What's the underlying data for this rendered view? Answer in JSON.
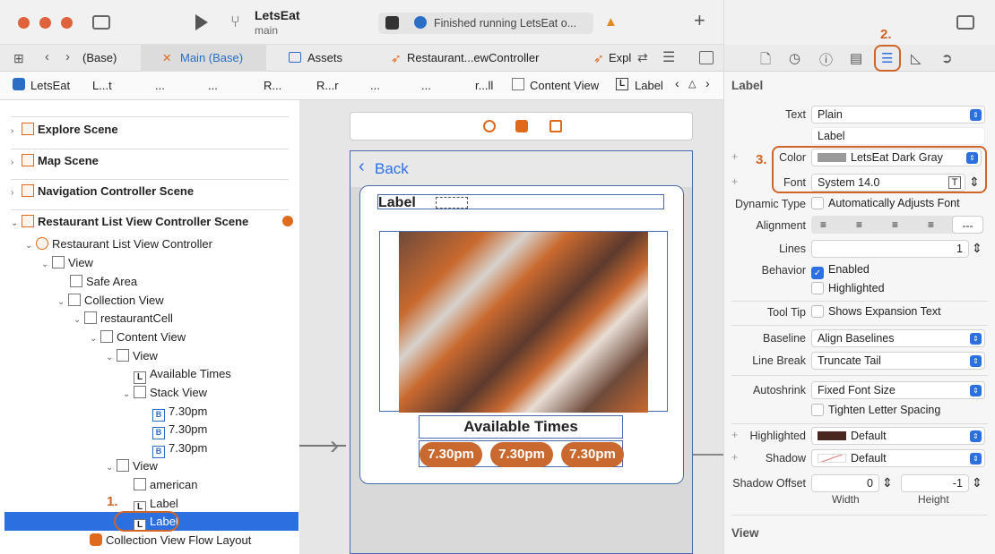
{
  "toolbar": {
    "project": "LetsEat",
    "branch": "main",
    "status": "Finished running LetsEat o...",
    "add": "+"
  },
  "tabs": [
    {
      "label": "(Base)"
    },
    {
      "label": "Main (Base)"
    },
    {
      "label": "Assets"
    },
    {
      "label": "Restaurant...ewController"
    },
    {
      "label": "Expl"
    }
  ],
  "breadcrumb": [
    "LetsEat",
    "L...t",
    "...",
    "...",
    "R...",
    "R...r",
    "...",
    "...",
    "r...ll",
    "...",
    "Content View",
    "Label"
  ],
  "outline": {
    "scenes": [
      "Explore Scene",
      "Map Scene",
      "Navigation Controller Scene",
      "Restaurant List View Controller Scene"
    ],
    "items": [
      "Restaurant List View Controller",
      "View",
      "Safe Area",
      "Collection View",
      "restaurantCell",
      "Content View",
      "View",
      "Available Times",
      "Stack View",
      "7.30pm",
      "7.30pm",
      "7.30pm",
      "View",
      "american",
      "Label",
      "Label",
      "Collection View Flow Layout"
    ]
  },
  "canvas": {
    "back": "Back",
    "label": "Label",
    "available": "Available Times",
    "times": [
      "7.30pm",
      "7.30pm",
      "7.30pm"
    ]
  },
  "inspector": {
    "section": "Label",
    "text_label": "Text",
    "text_value": "Plain",
    "text_content": "Label",
    "color_label": "Color",
    "color_value": "LetsEat Dark Gray",
    "font_label": "Font",
    "font_value": "System 14.0",
    "dynamic_label": "Dynamic Type",
    "dynamic_value": "Automatically Adjusts Font",
    "alignment_label": "Alignment",
    "lines_label": "Lines",
    "lines_value": "1",
    "behavior_label": "Behavior",
    "enabled": "Enabled",
    "highlighted": "Highlighted",
    "tooltip_label": "Tool Tip",
    "tooltip_value": "Shows Expansion Text",
    "baseline_label": "Baseline",
    "baseline_value": "Align Baselines",
    "linebreak_label": "Line Break",
    "linebreak_value": "Truncate Tail",
    "autoshrink_label": "Autoshrink",
    "autoshrink_value": "Fixed Font Size",
    "tighten": "Tighten Letter Spacing",
    "highlighted_label": "Highlighted",
    "highlighted_value": "Default",
    "shadow_label": "Shadow",
    "shadow_value": "Default",
    "offset_label": "Shadow Offset",
    "offset_w": "0",
    "offset_h": "-1",
    "width": "Width",
    "height": "Height",
    "view_section": "View"
  },
  "callouts": {
    "one": "1.",
    "two": "2.",
    "three": "3."
  },
  "colors": {
    "accent": "#d0652a",
    "selection": "#2b6fe0"
  }
}
